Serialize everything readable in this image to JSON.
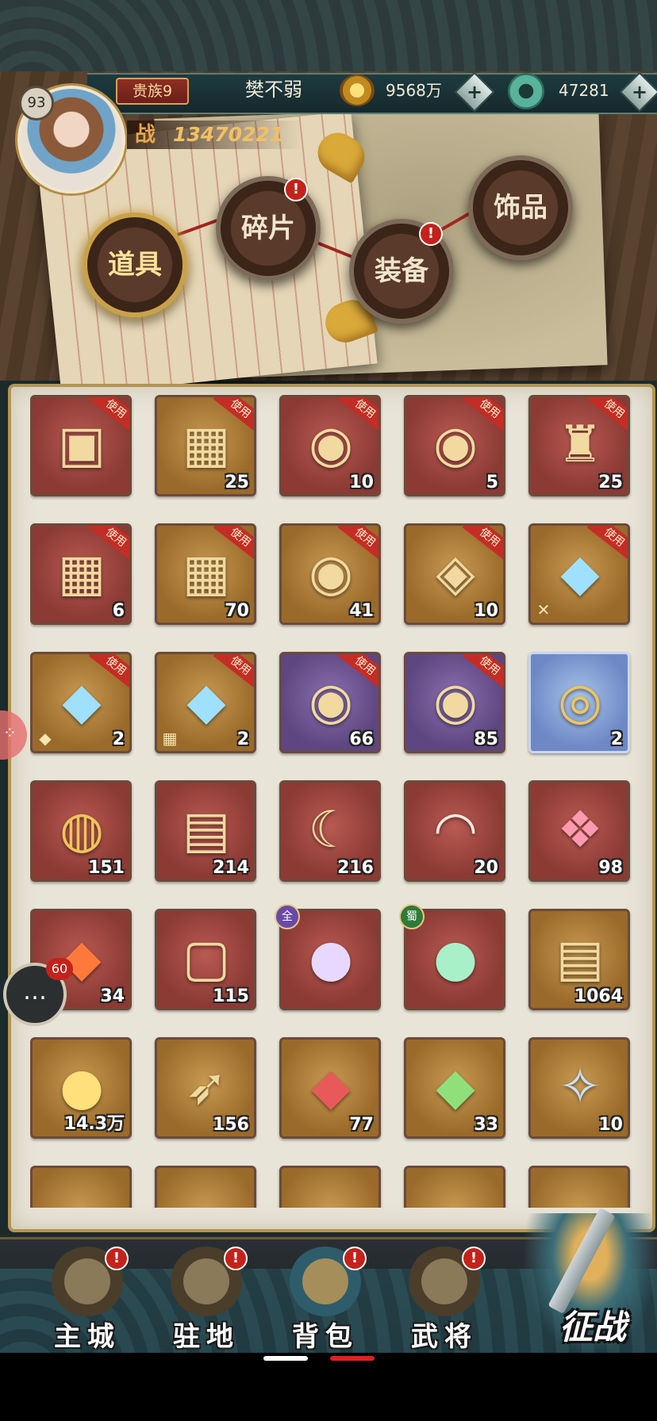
{
  "player": {
    "level": "93",
    "noble_rank": "贵族9",
    "name": "樊不弱",
    "combat_power_label": "战",
    "combat_power": "13470221"
  },
  "currency": {
    "gold": "9568万",
    "jade": "47281",
    "add_symbol": "+"
  },
  "categories": [
    {
      "label": "道具",
      "active": true,
      "alert": false
    },
    {
      "label": "碎片",
      "active": false,
      "alert": true
    },
    {
      "label": "装备",
      "active": false,
      "alert": true
    },
    {
      "label": "饰品",
      "active": false,
      "alert": false
    }
  ],
  "alert_symbol": "!",
  "use_label": "使用",
  "inventory": [
    {
      "name": "card-pack-icon",
      "quality": "red",
      "use": true,
      "count": ""
    },
    {
      "name": "hero-chest-icon",
      "quality": "gold",
      "use": true,
      "count": "25"
    },
    {
      "name": "orb-chest-icon",
      "quality": "red",
      "use": true,
      "count": "10"
    },
    {
      "name": "orb-chest-icon",
      "quality": "red",
      "use": true,
      "count": "5"
    },
    {
      "name": "relic-chest-icon",
      "quality": "red",
      "use": true,
      "count": "25"
    },
    {
      "name": "hero-chest-icon",
      "quality": "red",
      "use": true,
      "count": "6"
    },
    {
      "name": "hero-chest-icon",
      "quality": "gold",
      "use": true,
      "count": "70"
    },
    {
      "name": "orb-chest-icon",
      "quality": "gold",
      "use": true,
      "count": "41"
    },
    {
      "name": "gem-chest-icon",
      "quality": "gold",
      "use": true,
      "count": "10"
    },
    {
      "name": "crystal-chest-icon",
      "quality": "gold",
      "use": true,
      "count": "",
      "mark": "✕"
    },
    {
      "name": "crystal-chest-icon",
      "quality": "gold",
      "use": true,
      "count": "2",
      "mark": "◆"
    },
    {
      "name": "crystal-chest-icon",
      "quality": "gold",
      "use": true,
      "count": "2",
      "mark": "▦"
    },
    {
      "name": "orb-chest-icon",
      "quality": "purple",
      "use": true,
      "count": "66"
    },
    {
      "name": "orb-chest-icon",
      "quality": "purple",
      "use": true,
      "count": "85"
    },
    {
      "name": "golden-mirror-icon",
      "quality": "blue",
      "use": false,
      "count": "2"
    },
    {
      "name": "dragon-coin-icon",
      "quality": "red",
      "use": false,
      "count": "151"
    },
    {
      "name": "red-token-icon",
      "quality": "red",
      "use": false,
      "count": "214"
    },
    {
      "name": "tusk-icon",
      "quality": "red",
      "use": false,
      "count": "216"
    },
    {
      "name": "seashell-icon",
      "quality": "red",
      "use": false,
      "count": "20"
    },
    {
      "name": "red-crystal-icon",
      "quality": "red",
      "use": false,
      "count": "98"
    },
    {
      "name": "fire-gem-icon",
      "quality": "red",
      "use": false,
      "count": "34"
    },
    {
      "name": "jade-tablet-icon",
      "quality": "red",
      "use": false,
      "count": "115"
    },
    {
      "name": "purple-orb-icon",
      "quality": "red",
      "use": false,
      "count": "",
      "faction": "全",
      "faction_color": "#6a4aa8"
    },
    {
      "name": "green-orb-icon",
      "quality": "red",
      "use": false,
      "count": "",
      "faction": "蜀",
      "faction_color": "#2e7a3a"
    },
    {
      "name": "gold-token-icon",
      "quality": "gold",
      "use": false,
      "count": "1064"
    },
    {
      "name": "pearl-box-icon",
      "quality": "gold",
      "use": false,
      "count": "14.3万"
    },
    {
      "name": "arrow-icon",
      "quality": "gold",
      "use": false,
      "count": "156"
    },
    {
      "name": "red-ore-icon",
      "quality": "gold",
      "use": false,
      "count": "77"
    },
    {
      "name": "green-crystal-icon",
      "quality": "gold",
      "use": false,
      "count": "33"
    },
    {
      "name": "blue-fish-icon",
      "quality": "gold",
      "use": false,
      "count": "10"
    },
    {
      "name": "partial-item-icon",
      "quality": "gold",
      "use": false,
      "count": ""
    },
    {
      "name": "partial-item-icon",
      "quality": "gold",
      "use": false,
      "count": ""
    },
    {
      "name": "partial-item-icon",
      "quality": "gold",
      "use": false,
      "count": ""
    },
    {
      "name": "partial-item-icon",
      "quality": "gold",
      "use": false,
      "count": ""
    },
    {
      "name": "partial-item-icon",
      "quality": "gold",
      "use": false,
      "count": ""
    }
  ],
  "chat": {
    "unread": "60"
  },
  "nav": [
    {
      "label": "主城",
      "icon": "palace-icon",
      "alert": true,
      "active": false
    },
    {
      "label": "驻地",
      "icon": "camp-icon",
      "alert": true,
      "active": false
    },
    {
      "label": "背包",
      "icon": "bag-icon",
      "alert": true,
      "active": true
    },
    {
      "label": "武将",
      "icon": "general-icon",
      "alert": true,
      "active": false
    }
  ],
  "battle": {
    "label": "征战"
  },
  "colors": {
    "accent_gold": "#c9a248",
    "alert_red": "#c4221a",
    "panel_bg": "#e8e4d8"
  }
}
